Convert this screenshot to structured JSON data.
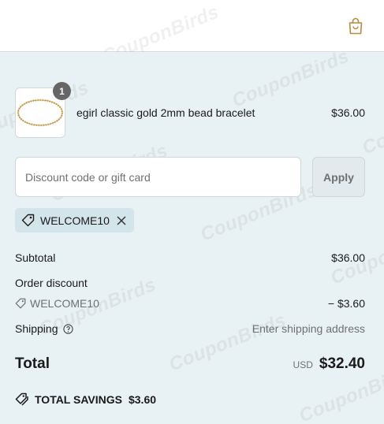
{
  "watermark": {
    "text": "CouponBirds"
  },
  "header": {
    "cart_icon": "shopping-bag-icon"
  },
  "cart": {
    "items": [
      {
        "name": "egirl classic gold 2mm bead bracelet",
        "price": "$36.00",
        "quantity": "1",
        "image_icon": "gold-bead-bracelet-image"
      }
    ]
  },
  "discount": {
    "placeholder": "Discount code or gift card",
    "value": "",
    "apply_label": "Apply",
    "applied_code": "WELCOME10",
    "tag_icon": "tag-icon",
    "remove_icon": "close-icon"
  },
  "summary": {
    "subtotal_label": "Subtotal",
    "subtotal_value": "$36.00",
    "order_discount_label": "Order discount",
    "discount_code": "WELCOME10",
    "discount_value": "− $3.60",
    "shipping_label": "Shipping",
    "shipping_value": "Enter shipping address",
    "total_label": "Total",
    "currency": "USD",
    "total_value": "$32.40",
    "savings_label": "TOTAL SAVINGS",
    "savings_value": "$3.60"
  },
  "colors": {
    "background": "#e8f1f4",
    "accent_gold": "#b8893a",
    "chip": "#d3e4ea",
    "muted_text": "#707070"
  }
}
